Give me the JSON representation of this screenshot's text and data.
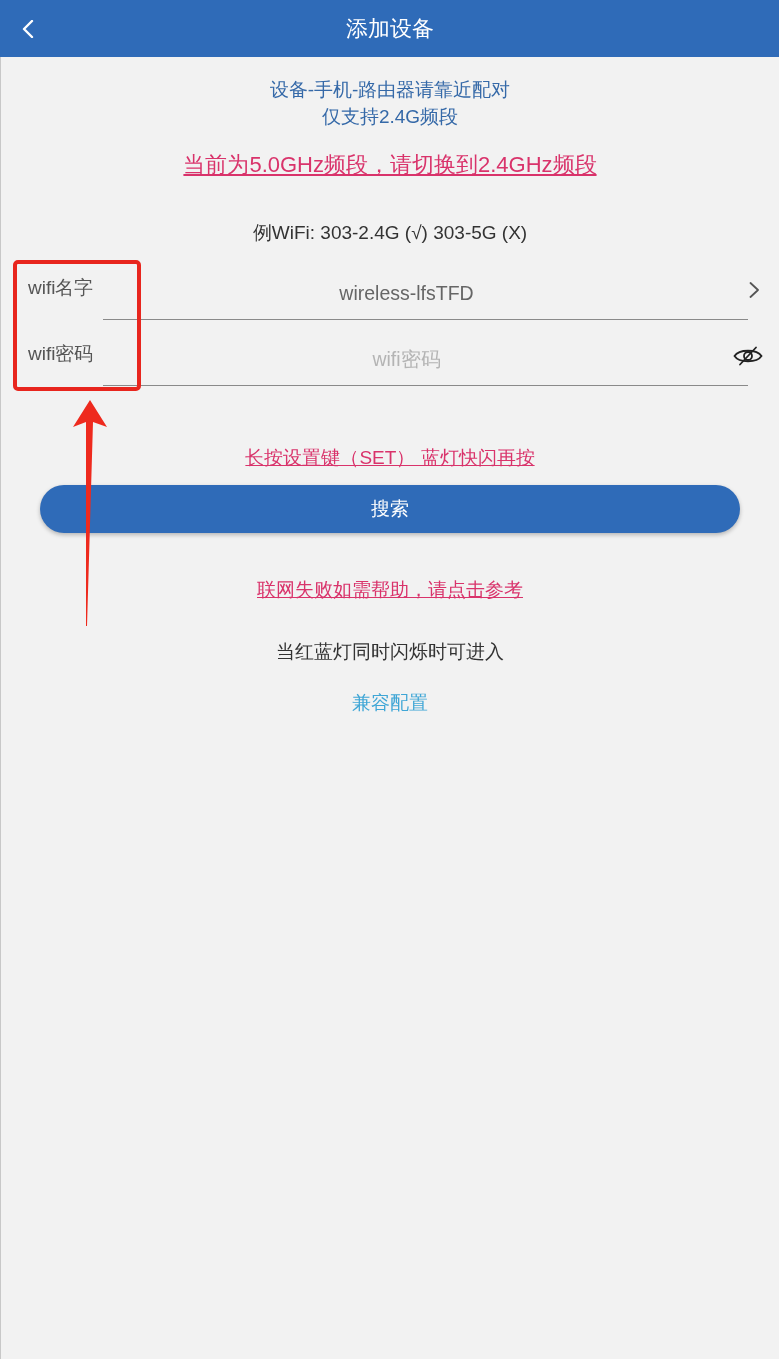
{
  "header": {
    "title": "添加设备"
  },
  "notice": {
    "lines": [
      "设备-手机-路由器请靠近配对",
      "仅支持2.4G频段"
    ]
  },
  "band_warning": "当前为5.0GHz频段，请切换到2.4GHz频段",
  "example": "例WiFi: 303-2.4G (√) 303-5G (X)",
  "fields": [
    {
      "kind": "select",
      "label": "wifi名字",
      "value": "wireless-lfsTFD"
    },
    {
      "kind": "password",
      "label": "wifi密码",
      "placeholder": "wifi密码",
      "password_visible": false
    }
  ],
  "set_hint": "长按设置键（SET） 蓝灯快闪再按",
  "search_button": "搜索",
  "help_link": "联网失败如需帮助，请点击参考",
  "compat_note": "当红蓝灯同时闪烁时可进入",
  "compat_link": "兼容配置"
}
